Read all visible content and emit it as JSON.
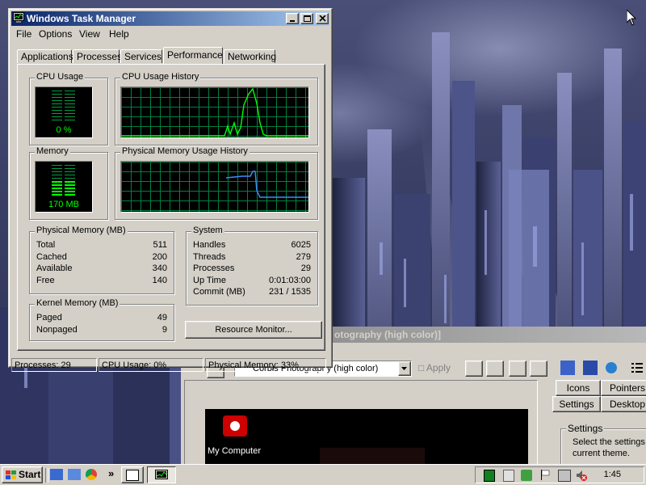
{
  "window": {
    "title": "Windows Task Manager",
    "menu": [
      "File",
      "Options",
      "View",
      "Help"
    ],
    "tabs": [
      "Applications",
      "Processes",
      "Services",
      "Performance",
      "Networking"
    ],
    "active_tab": "Performance"
  },
  "performance": {
    "cpu_usage_title": "CPU Usage",
    "cpu_usage_value": "0 %",
    "cpu_history_title": "CPU Usage History",
    "memory_title": "Memory",
    "memory_value": "170 MB",
    "memory_history_title": "Physical Memory Usage History",
    "physical_memory": {
      "title": "Physical Memory (MB)",
      "rows": [
        {
          "label": "Total",
          "value": "511"
        },
        {
          "label": "Cached",
          "value": "200"
        },
        {
          "label": "Available",
          "value": "340"
        },
        {
          "label": "Free",
          "value": "140"
        }
      ]
    },
    "kernel_memory": {
      "title": "Kernel Memory (MB)",
      "rows": [
        {
          "label": "Paged",
          "value": "49"
        },
        {
          "label": "Nonpaged",
          "value": "9"
        }
      ]
    },
    "system": {
      "title": "System",
      "rows": [
        {
          "label": "Handles",
          "value": "6025"
        },
        {
          "label": "Threads",
          "value": "279"
        },
        {
          "label": "Processes",
          "value": "29"
        },
        {
          "label": "Up Time",
          "value": "0:01:03:00"
        },
        {
          "label": "Commit (MB)",
          "value": "231 / 1535"
        }
      ]
    },
    "resource_monitor_button": "Resource Monitor..."
  },
  "status_bar": {
    "processes": "Processes: 29",
    "cpu": "CPU Usage: 0%",
    "memory": "Physical Memory: 33%"
  },
  "background_window": {
    "title": "otography (high color)]",
    "theme_combo": "Corbis Photography (high color)",
    "apply_label": "Apply",
    "tabs_top": [
      "Icons",
      "Pointers"
    ],
    "tabs_bottom": [
      "Settings",
      "Desktop"
    ],
    "settings_group": "Settings",
    "settings_text_1": "Select the settings",
    "settings_text_2": "current theme.",
    "icon_label": "My Computer"
  },
  "taskbar": {
    "start_label": "Start",
    "quicklaunch_more": "»",
    "clock": "1:45"
  },
  "colors": {
    "title_active_start": "#0a246a",
    "title_active_end": "#a6caf0",
    "monitor_green": "#00ff00",
    "grid_green": "#008040",
    "memory_line_blue": "#3b8dff"
  }
}
